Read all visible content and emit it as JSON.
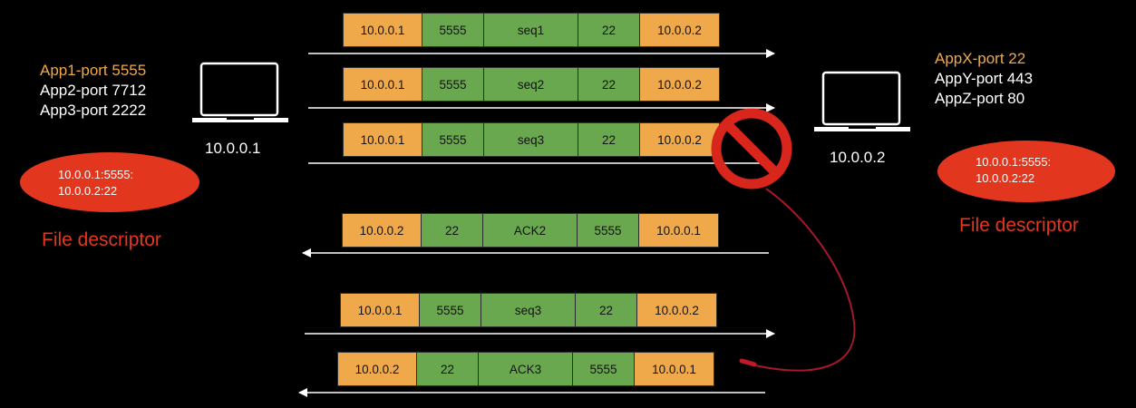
{
  "left_host": {
    "apps": [
      {
        "label": "App1-port 5555",
        "active": true
      },
      {
        "label": "App2-port 7712",
        "active": false
      },
      {
        "label": "App3-port 2222",
        "active": false
      }
    ],
    "ip": "10.0.0.1",
    "fd_lines": [
      "10.0.0.1:5555:",
      "10.0.0.2:22"
    ],
    "fd_label": "File descriptor"
  },
  "right_host": {
    "apps": [
      {
        "label": "AppX-port 22",
        "active": true
      },
      {
        "label": "AppY-port 443",
        "active": false
      },
      {
        "label": "AppZ-port 80",
        "active": false
      }
    ],
    "ip": "10.0.0.2",
    "fd_lines": [
      "10.0.0.1:5555:",
      "10.0.0.2:22"
    ],
    "fd_label": "File descriptor"
  },
  "packets": [
    {
      "cells": [
        "10.0.0.1",
        "5555",
        "seq1",
        "22",
        "10.0.0.2"
      ],
      "direction": "right"
    },
    {
      "cells": [
        "10.0.0.1",
        "5555",
        "seq2",
        "22",
        "10.0.0.2"
      ],
      "direction": "right"
    },
    {
      "cells": [
        "10.0.0.1",
        "5555",
        "seq3",
        "22",
        "10.0.0.2"
      ],
      "direction": "right",
      "dropped": true
    },
    {
      "cells": [
        "10.0.0.2",
        "22",
        "ACK2",
        "5555",
        "10.0.0.1"
      ],
      "direction": "left"
    },
    {
      "cells": [
        "10.0.0.1",
        "5555",
        "seq3",
        "22",
        "10.0.0.2"
      ],
      "direction": "right"
    },
    {
      "cells": [
        "10.0.0.2",
        "22",
        "ACK3",
        "5555",
        "10.0.0.1"
      ],
      "direction": "left"
    }
  ],
  "colors": {
    "background": "#000000",
    "ip_field": "#f0a94a",
    "port_field": "#6aa84f",
    "highlight_text": "#f0a94a",
    "fd_ellipse": "#e2361f",
    "drop_icon": "#d9261c",
    "retransmit_curve": "#a3182a"
  },
  "icons": [
    "laptop-icon",
    "prohibited-icon"
  ]
}
